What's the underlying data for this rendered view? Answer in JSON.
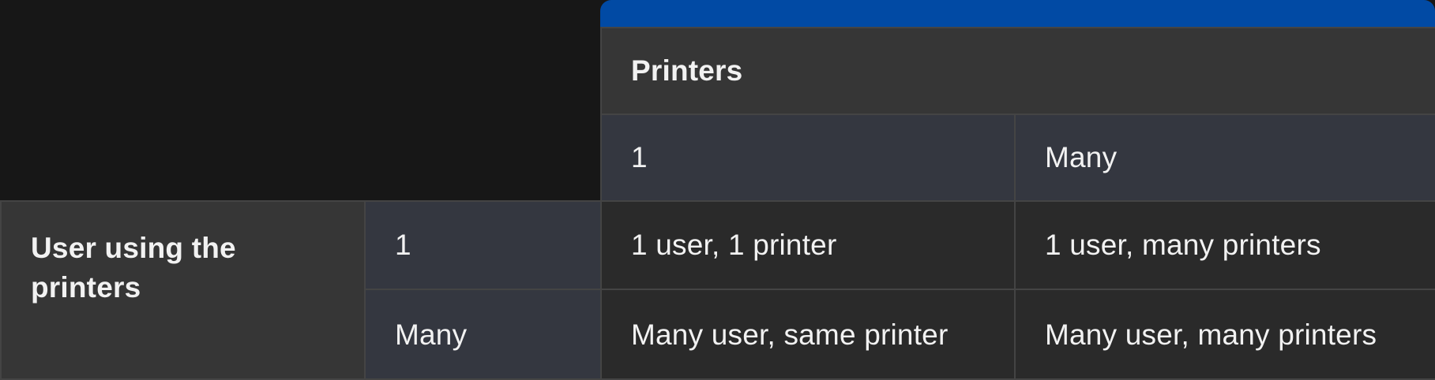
{
  "column_group_header": "Printers",
  "column_subheaders": [
    "1",
    "Many"
  ],
  "row_group_header": "User using the printers",
  "rows": [
    {
      "label": "1",
      "cells": [
        "1 user, 1 printer",
        "1 user, many printers"
      ]
    },
    {
      "label": "Many",
      "cells": [
        "Many user, same printer",
        "Many user, many printers"
      ]
    }
  ],
  "colors": {
    "accent": "#014aa4",
    "page_background": "#171717",
    "header_background": "#363636",
    "subheader_background": "#343740",
    "cell_background": "#2a2a2a",
    "grid_line": "#444444",
    "text": "#f2f2f2"
  }
}
